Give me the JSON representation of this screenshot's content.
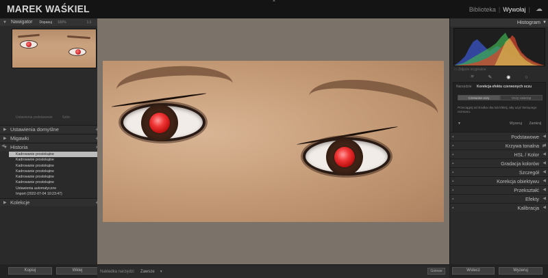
{
  "app": {
    "brand": "MAREK WAŚKIEL",
    "modules": [
      "Biblioteka",
      "Wywołaj"
    ],
    "active_module": "Wywołaj",
    "cloud_icon": "cloud-icon"
  },
  "left_panel": {
    "navigator": {
      "title": "Nawigator",
      "options": [
        "Dopasuj",
        "100%",
        "1:1"
      ],
      "selected": "Dopasuj",
      "footer": [
        "Ustawienia podstawowe",
        "Szkic"
      ]
    },
    "sections": [
      {
        "label": "Ustawienia domyślne"
      },
      {
        "label": "Migawki"
      },
      {
        "label": "Historia"
      },
      {
        "label": "Kolekcje"
      }
    ],
    "history_items": [
      "Kadrowanie prostokątne",
      "Kadrowanie prostokątne",
      "Kadrowanie prostokątne",
      "Kadrowanie prostokątne",
      "Kadrowanie prostokątne",
      "Kadrowanie prostokątne",
      "Ustawienia automatyczne",
      "Import (2022-07-04 10:23:47)"
    ],
    "buttons": {
      "copy": "Kopiuj",
      "paste": "Wklej"
    }
  },
  "center": {
    "toolbar": {
      "show_tool": "Nakładka narzędzi:",
      "mode": "Zawsze",
      "done": "Gotowe"
    }
  },
  "right_panel": {
    "histogram_title": "Histogram",
    "original_photo": "Zdjęcie oryginalne",
    "tools": [
      "crop-icon",
      "spot-heal-icon",
      "red-eye-icon",
      "brush-icon"
    ],
    "redeye": {
      "label": "Narzędzie",
      "title": "Korekcja efektu czerwonych oczu",
      "tabs": [
        "Czerwone oczy",
        "Oczy zwierząt"
      ],
      "hint": "Przeciągnij od środka oka lub kliknij, aby użyć bieżącego rozmiaru.",
      "reset": "Wyzeruj",
      "close": "Zamknij"
    },
    "sections": [
      {
        "label": "Podstawowe"
      },
      {
        "label": "Krzywa tonalna"
      },
      {
        "label": "HSL / Kolor"
      },
      {
        "label": "Gradacja kolorów"
      },
      {
        "label": "Szczegół"
      },
      {
        "label": "Korekcja obiektywu"
      },
      {
        "label": "Przekształć"
      },
      {
        "label": "Efekty"
      },
      {
        "label": "Kalibracja"
      }
    ],
    "buttons": {
      "previous": "Wstecz",
      "reset": "Wyzeruj"
    }
  },
  "colors": {
    "red_eye": "#e83030",
    "background": "#7b726a"
  }
}
